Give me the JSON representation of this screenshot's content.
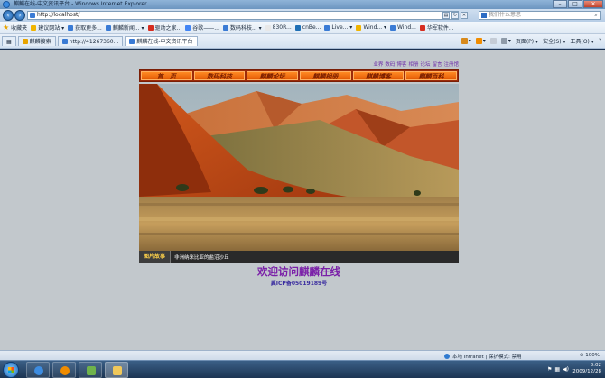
{
  "window": {
    "title": "麒麟在线-中文资讯平台 - Windows Internet Explorer",
    "buttons": {
      "minimize": "–",
      "maximize": "□",
      "close": "✕"
    }
  },
  "address_bar": {
    "url": "http://localhost/",
    "search_placeholder": "我们什么意思"
  },
  "favorites_bar": {
    "favorites_label": "收藏夹",
    "items": [
      "建议网站 ▾",
      "获取更多...",
      "麒麟新闻... ▾",
      "驱动之家...",
      "谷歌——...",
      "数码科技... ▾",
      "830R...",
      "cnBe...",
      "Live... ▾",
      "Wind... ▾",
      "Wind...",
      "华军软件..."
    ]
  },
  "tabs": [
    {
      "label": "麒麟搜索"
    },
    {
      "label": "http://41267360..."
    },
    {
      "label": "麒麟在线-中文资讯平台"
    }
  ],
  "command_bar": {
    "page": "页面(P) ▾",
    "safety": "安全(S) ▾",
    "tools": "工具(O) ▾",
    "help": "?"
  },
  "site": {
    "top_links": [
      "业界",
      "数码",
      "博客",
      "相册",
      "论坛",
      "留言",
      "注册馆"
    ],
    "nav": [
      "首　页",
      "数码科技",
      "麒麟论坛",
      "麒麟相册",
      "麒麟博客",
      "麒麟百科"
    ],
    "caption_label": "图片故事",
    "caption_text": "非洲纳米比亚的盐沼沙丘",
    "welcome": "欢迎访问麒麟在线",
    "icp": "冀ICP备05019189号"
  },
  "status_bar": {
    "zone": "本地 Intranet | 保护模式: 禁用",
    "zoom": "100%"
  },
  "tray": {
    "time": "8:02",
    "date": "2009/12/28"
  },
  "colors": {
    "nav_orange": "#f07010",
    "link_purple": "#6e2fa8",
    "welcome_purple": "#7a1fa8",
    "page_bg": "#c2c8cc"
  }
}
